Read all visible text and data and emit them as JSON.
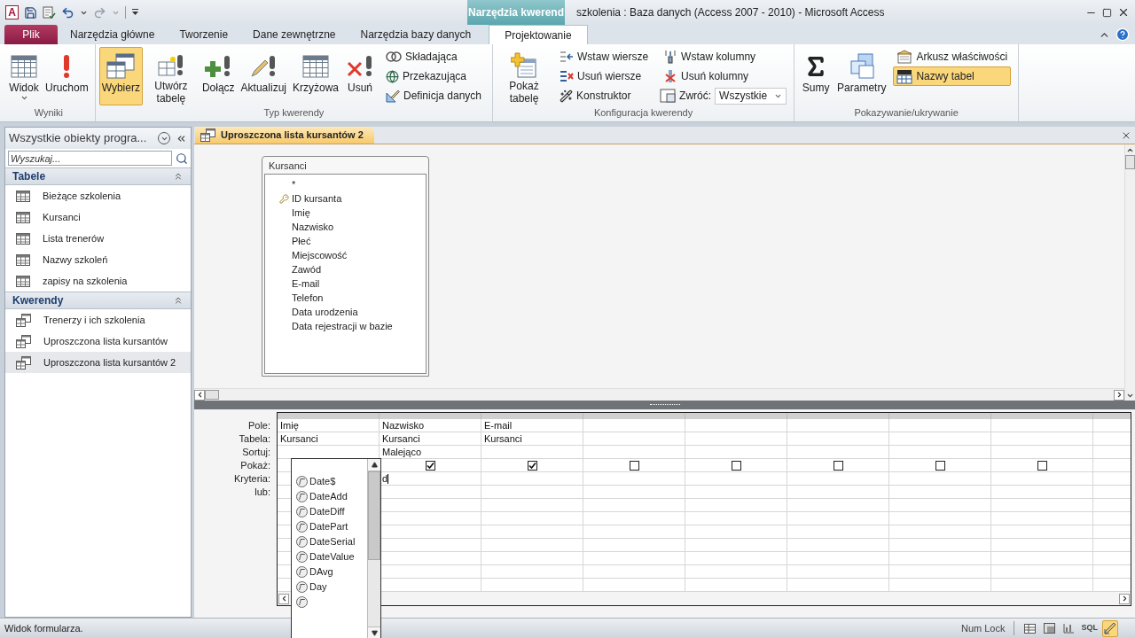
{
  "window": {
    "logo": "A",
    "title": "szkolenia : Baza danych (Access 2007 - 2010)  -  Microsoft Access",
    "context_tab": "Narzędzia kwerend"
  },
  "ribbon_tabs": [
    {
      "label": "Plik",
      "kind": "file",
      "selected": false
    },
    {
      "label": "Narzędzia główne",
      "kind": "tab",
      "selected": false
    },
    {
      "label": "Tworzenie",
      "kind": "tab",
      "selected": false
    },
    {
      "label": "Dane zewnętrzne",
      "kind": "tab",
      "selected": false
    },
    {
      "label": "Narzędzia bazy danych",
      "kind": "tab",
      "selected": false
    },
    {
      "label": "Projektowanie",
      "kind": "context",
      "selected": true
    }
  ],
  "ribbon_groups": [
    {
      "label": "Wyniki",
      "items": [
        {
          "label": "Widok",
          "kind": "split",
          "selected": false
        },
        {
          "label": "Uruchom",
          "kind": "large",
          "selected": false
        }
      ]
    },
    {
      "label": "Typ kwerendy",
      "items": [
        {
          "label": "Wybierz",
          "kind": "large",
          "selected": true
        },
        {
          "label": "Utwórz tabelę",
          "kind": "large",
          "selected": false
        },
        {
          "label": "Dołącz",
          "kind": "large",
          "selected": false
        },
        {
          "label": "Aktualizuj",
          "kind": "large",
          "selected": false
        },
        {
          "label": "Krzyżowa",
          "kind": "large",
          "selected": false
        },
        {
          "label": "Usuń",
          "kind": "large",
          "selected": false
        },
        {
          "label": "Składająca",
          "kind": "small",
          "selected": false
        },
        {
          "label": "Przekazująca",
          "kind": "small",
          "selected": false
        },
        {
          "label": "Definicja danych",
          "kind": "small",
          "selected": false
        }
      ]
    },
    {
      "label": "Konfiguracja kwerendy",
      "items": [
        {
          "label": "Pokaż tabelę",
          "kind": "large",
          "selected": false
        },
        {
          "label": "Wstaw wiersze",
          "kind": "small",
          "selected": false
        },
        {
          "label": "Usuń wiersze",
          "kind": "small",
          "selected": false
        },
        {
          "label": "Konstruktor",
          "kind": "small",
          "selected": false
        },
        {
          "label": "Wstaw kolumny",
          "kind": "small",
          "selected": false
        },
        {
          "label": "Usuń kolumny",
          "kind": "small",
          "selected": false
        },
        {
          "label": "Zwróć:",
          "kind": "dropdown",
          "value": "Wszystkie",
          "selected": false
        }
      ]
    },
    {
      "label": "Pokazywanie/ukrywanie",
      "items": [
        {
          "label": "Sumy",
          "kind": "large",
          "selected": false
        },
        {
          "label": "Parametry",
          "kind": "large",
          "selected": false
        },
        {
          "label": "Arkusz właściwości",
          "kind": "small",
          "selected": false
        },
        {
          "label": "Nazwy tabel",
          "kind": "small",
          "selected": true
        }
      ]
    }
  ],
  "nav_pane": {
    "title": "Wszystkie obiekty progra...",
    "search_placeholder": "Wyszukaj...",
    "sections": [
      {
        "label": "Tabele",
        "kind": "tables",
        "expanded": true,
        "items": [
          {
            "label": "Bieżące szkolenia",
            "selected": false
          },
          {
            "label": "Kursanci",
            "selected": false
          },
          {
            "label": "Lista trenerów",
            "selected": false
          },
          {
            "label": "Nazwy szkoleń",
            "selected": false
          },
          {
            "label": "zapisy na szkolenia",
            "selected": false
          }
        ]
      },
      {
        "label": "Kwerendy",
        "kind": "queries",
        "expanded": true,
        "items": [
          {
            "label": "Trenerzy i ich szkolenia",
            "selected": false
          },
          {
            "label": "Uproszczona lista kursantów",
            "selected": false
          },
          {
            "label": "Uproszczona lista kursantów 2",
            "selected": true
          }
        ]
      }
    ]
  },
  "document": {
    "tab": "Uproszczona lista kursantów 2"
  },
  "table_box": {
    "title": "Kursanci",
    "fields": [
      {
        "label": "*",
        "primary_key": false
      },
      {
        "label": "ID kursanta",
        "primary_key": true
      },
      {
        "label": "Imię",
        "primary_key": false
      },
      {
        "label": "Nazwisko",
        "primary_key": false
      },
      {
        "label": "Płeć",
        "primary_key": false
      },
      {
        "label": "Miejscowość",
        "primary_key": false
      },
      {
        "label": "Zawód",
        "primary_key": false
      },
      {
        "label": "E-mail",
        "primary_key": false
      },
      {
        "label": "Telefon",
        "primary_key": false
      },
      {
        "label": "Data urodzenia",
        "primary_key": false
      },
      {
        "label": "Data rejestracji w bazie",
        "primary_key": false
      }
    ]
  },
  "grid": {
    "row_labels": [
      "Pole:",
      "Tabela:",
      "Sortuj:",
      "Pokaż:",
      "Kryteria:",
      "lub:"
    ],
    "columns": [
      {
        "field": "Imię",
        "table": "Kursanci",
        "editing": false
      },
      {
        "field": "Nazwisko",
        "table": "Kursanci",
        "sort": "Malejąco",
        "show": true,
        "criteria": "d",
        "editing": true
      },
      {
        "field": "E-mail",
        "table": "Kursanci",
        "show": true,
        "editing": false
      },
      {
        "show": false,
        "editing": false
      },
      {
        "show": false,
        "editing": false
      },
      {
        "show": false,
        "editing": false
      },
      {
        "show": false,
        "editing": false
      },
      {
        "show": false,
        "editing": false
      }
    ]
  },
  "autocomplete": {
    "items": [
      {
        "label": "Date$",
        "kind": "function"
      },
      {
        "label": "DateAdd",
        "kind": "function"
      },
      {
        "label": "DateDiff",
        "kind": "function"
      },
      {
        "label": "DatePart",
        "kind": "function"
      },
      {
        "label": "DateSerial",
        "kind": "function"
      },
      {
        "label": "DateValue",
        "kind": "function"
      },
      {
        "label": "DAvg",
        "kind": "function"
      },
      {
        "label": "Day",
        "kind": "function"
      },
      {
        "kind": "cut"
      }
    ]
  },
  "status_bar": {
    "text": "Widok formularza.",
    "indicator": "Num Lock",
    "views": [
      {
        "kind": "datasheet",
        "selected": false
      },
      {
        "kind": "pivot_table",
        "selected": false
      },
      {
        "kind": "pivot_chart",
        "selected": false
      },
      {
        "kind": "sql",
        "label": "SQL",
        "selected": false
      },
      {
        "kind": "design",
        "selected": true
      }
    ]
  }
}
